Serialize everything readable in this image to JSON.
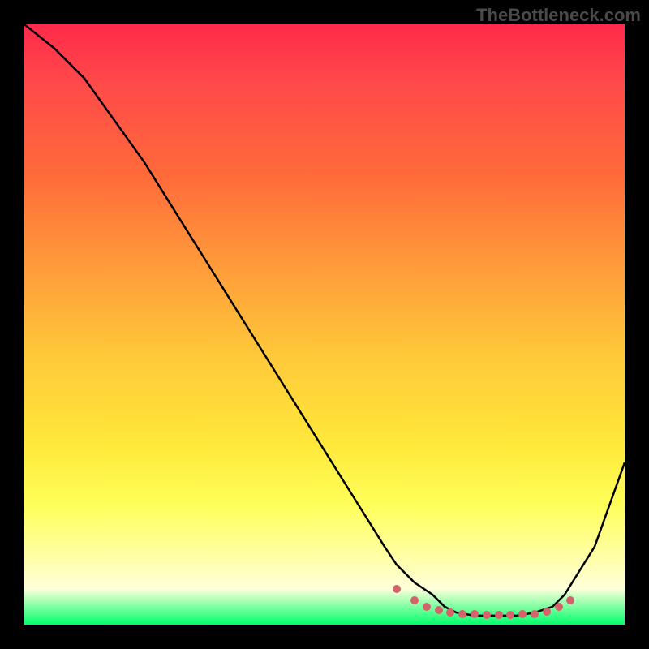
{
  "watermark": "TheBottleneck.com",
  "chart_data": {
    "type": "line",
    "title": "",
    "xlabel": "",
    "ylabel": "",
    "xlim": [
      0,
      100
    ],
    "ylim": [
      0,
      100
    ],
    "series": [
      {
        "name": "curve",
        "x": [
          0,
          5,
          10,
          15,
          20,
          25,
          30,
          35,
          40,
          45,
          50,
          55,
          60,
          62,
          65,
          68,
          70,
          72,
          75,
          78,
          80,
          82,
          85,
          88,
          90,
          95,
          100
        ],
        "y": [
          100,
          96,
          91,
          84,
          77,
          69,
          61,
          53,
          45,
          37,
          29,
          21,
          13,
          10,
          7,
          5,
          3,
          2,
          1.5,
          1.5,
          1.5,
          1.5,
          2,
          3,
          5,
          13,
          27
        ]
      }
    ],
    "highlight_dots": {
      "x": [
        62,
        65,
        67,
        69,
        71,
        73,
        75,
        77,
        79,
        81,
        83,
        85,
        87,
        89,
        91
      ],
      "y": [
        6,
        4,
        3,
        2.5,
        2,
        1.8,
        1.7,
        1.6,
        1.6,
        1.6,
        1.7,
        1.8,
        2.2,
        3,
        4
      ]
    },
    "gradient_colors": {
      "top": "#ff2a4a",
      "mid1": "#ff9a3a",
      "mid2": "#ffe83a",
      "bottom": "#00ff6a"
    }
  }
}
